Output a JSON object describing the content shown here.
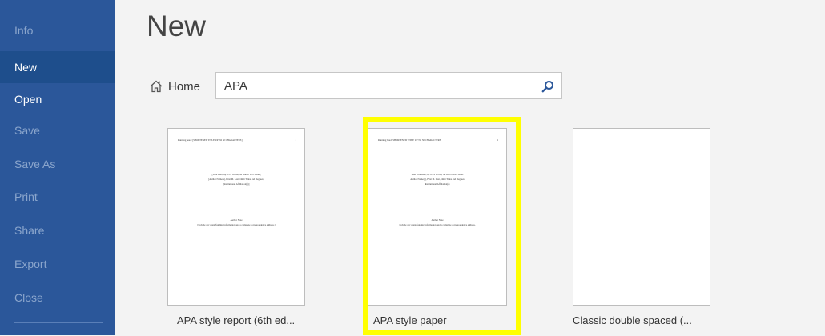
{
  "sidebar": {
    "items": [
      {
        "label": "Info",
        "state": "disabled"
      },
      {
        "label": "New",
        "state": "active"
      },
      {
        "label": "Open",
        "state": "enabled"
      },
      {
        "label": "Save",
        "state": "disabled"
      },
      {
        "label": "Save As",
        "state": "disabled"
      },
      {
        "label": "Print",
        "state": "disabled"
      },
      {
        "label": "Share",
        "state": "disabled"
      },
      {
        "label": "Export",
        "state": "disabled"
      },
      {
        "label": "Close",
        "state": "disabled"
      }
    ]
  },
  "header": {
    "title": "New"
  },
  "search": {
    "home_label": "Home",
    "value": "APA",
    "search_icon": "search-icon",
    "home_icon": "home-icon"
  },
  "templates": [
    {
      "name": "APA style report (6th ed...",
      "selected": false,
      "preview": {
        "running_head": "Running head: [SHORTENED TITLE UP TO 50 CHARACTERS]",
        "page_number": "1",
        "title_lines": [
          "[Title Here, up to 12 Words, on One to Two Lines]",
          "[Author Name(s), First M. Last, Omit Titles and Degrees]",
          "[Institutional Affiliation(s)]"
        ],
        "note_heading": "Author Note",
        "note_line": "[Include any grant/funding information and a complete correspondence address.]"
      }
    },
    {
      "name": "APA style paper",
      "selected": true,
      "preview": {
        "running_head": "Running head: SHORTENED TITLE UP TO 50 CHARACTERS",
        "page_number": "1",
        "title_lines": [
          "Add Title Here, up to 12 Words, on One to Two Lines",
          "Author Name(s), First M. Last, Omit Titles and Degrees",
          "Institutional Affiliation(s)"
        ],
        "note_heading": "Author Note",
        "note_line": "Include any grant/funding information and a complete correspondence address."
      }
    },
    {
      "name": "Classic double spaced (...",
      "selected": false,
      "preview": null
    }
  ],
  "colors": {
    "sidebar_bg": "#2b579a",
    "sidebar_active": "#1e4e8c",
    "highlight": "#ffff00",
    "page_bg": "#f3f3f3"
  }
}
